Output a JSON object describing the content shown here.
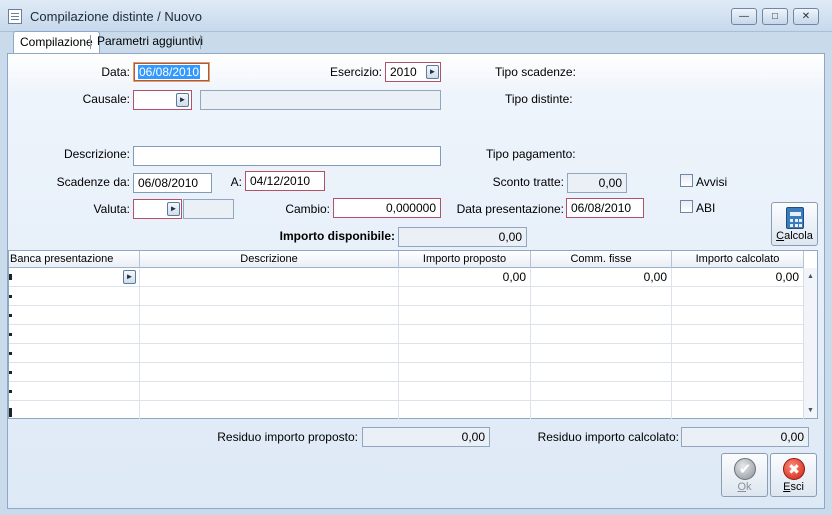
{
  "window": {
    "title": "Compilazione distinte / Nuovo",
    "minimize": "—",
    "maximize": "□",
    "close": "✕"
  },
  "tabs": [
    {
      "label": "Compilazione",
      "active": true
    },
    {
      "label": "Parametri aggiuntivi",
      "active": false
    }
  ],
  "form": {
    "data_label": "Data:",
    "data_value": "06/08/2010",
    "esercizio_label": "Esercizio:",
    "esercizio_value": "2010",
    "tipo_scadenze_label": "Tipo scadenze:",
    "causale_label": "Causale:",
    "causale_value": "",
    "causale_desc": "",
    "tipo_distinte_label": "Tipo distinte:",
    "descrizione_label": "Descrizione:",
    "descrizione_value": "",
    "tipo_pagamento_label": "Tipo pagamento:",
    "scadenze_da_label": "Scadenze da:",
    "scadenze_da_value": "06/08/2010",
    "a_label": "A:",
    "a_value": "04/12/2010",
    "sconto_tratte_label": "Sconto tratte:",
    "sconto_tratte_value": "0,00",
    "avvisi_label": "Avvisi",
    "valuta_label": "Valuta:",
    "valuta_value": "",
    "valuta_desc": "",
    "cambio_label": "Cambio:",
    "cambio_value": "0,000000",
    "data_presentazione_label": "Data presentazione:",
    "data_presentazione_value": "06/08/2010",
    "abi_label": "ABI",
    "importo_disponibile_label": "Importo disponibile:",
    "importo_disponibile_value": "0,00",
    "calcola_label_pre": "",
    "calcola_label_u": "C",
    "calcola_label_post": "alcola"
  },
  "grid": {
    "columns": [
      "Banca presentazione",
      "Descrizione",
      "Importo proposto",
      "Comm. fisse",
      "Importo calcolato"
    ],
    "rows": [
      {
        "banca": "",
        "descrizione": "",
        "importo_proposto": "0,00",
        "comm_fisse": "0,00",
        "importo_calcolato": "0,00"
      }
    ]
  },
  "footer": {
    "residuo_proposto_label": "Residuo importo proposto:",
    "residuo_proposto_value": "0,00",
    "residuo_calcolato_label": "Residuo importo calcolato:",
    "residuo_calcolato_value": "0,00",
    "ok_u": "O",
    "ok_rest": "k",
    "esci_u": "E",
    "esci_rest": "sci"
  },
  "colors": {
    "required_border": "#b0506a",
    "selection": "#3399ff",
    "panel_border": "#8ea8c7"
  },
  "icons": [
    "document-icon",
    "zoom-arrow-icon",
    "calculator-icon",
    "checkmark-icon",
    "close-x-icon"
  ]
}
